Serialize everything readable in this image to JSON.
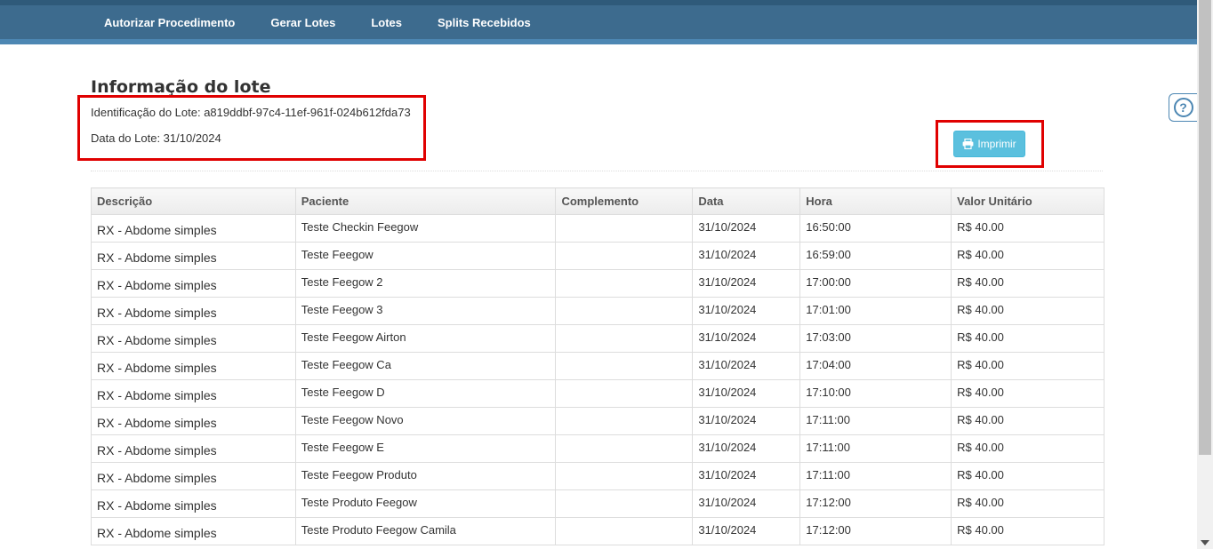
{
  "nav": {
    "items": [
      {
        "label": "Autorizar Procedimento"
      },
      {
        "label": "Gerar Lotes"
      },
      {
        "label": "Lotes"
      },
      {
        "label": "Splits Recebidos"
      }
    ]
  },
  "help": {
    "icon": "question-icon",
    "glyph": "?"
  },
  "lote": {
    "title": "Informação do lote",
    "identificacao": "Identificação do Lote: a819ddbf-97c4-11ef-961f-024b612fda73",
    "data": "Data do Lote: 31/10/2024"
  },
  "print_button": {
    "label": "Imprimir",
    "icon": "printer-icon"
  },
  "table": {
    "headers": [
      "Descrição",
      "Paciente",
      "Complemento",
      "Data",
      "Hora",
      "Valor Unitário"
    ],
    "rows": [
      [
        "RX - Abdome simples",
        "Teste Checkin Feegow",
        "",
        "31/10/2024",
        "16:50:00",
        "R$ 40.00"
      ],
      [
        "RX - Abdome simples",
        "Teste Feegow",
        "",
        "31/10/2024",
        "16:59:00",
        "R$ 40.00"
      ],
      [
        "RX - Abdome simples",
        "Teste Feegow 2",
        "",
        "31/10/2024",
        "17:00:00",
        "R$ 40.00"
      ],
      [
        "RX - Abdome simples",
        "Teste Feegow 3",
        "",
        "31/10/2024",
        "17:01:00",
        "R$ 40.00"
      ],
      [
        "RX - Abdome simples",
        "Teste Feegow Airton",
        "",
        "31/10/2024",
        "17:03:00",
        "R$ 40.00"
      ],
      [
        "RX - Abdome simples",
        "Teste Feegow Ca",
        "",
        "31/10/2024",
        "17:04:00",
        "R$ 40.00"
      ],
      [
        "RX - Abdome simples",
        "Teste Feegow D",
        "",
        "31/10/2024",
        "17:10:00",
        "R$ 40.00"
      ],
      [
        "RX - Abdome simples",
        "Teste Feegow Novo",
        "",
        "31/10/2024",
        "17:11:00",
        "R$ 40.00"
      ],
      [
        "RX - Abdome simples",
        "Teste Feegow E",
        "",
        "31/10/2024",
        "17:11:00",
        "R$ 40.00"
      ],
      [
        "RX - Abdome simples",
        "Teste Feegow Produto",
        "",
        "31/10/2024",
        "17:11:00",
        "R$ 40.00"
      ],
      [
        "RX - Abdome simples",
        "Teste Produto Feegow",
        "",
        "31/10/2024",
        "17:12:00",
        "R$ 40.00"
      ],
      [
        "RX - Abdome simples",
        "Teste Produto Feegow Camila",
        "",
        "31/10/2024",
        "17:12:00",
        "R$ 40.00"
      ]
    ]
  },
  "colors": {
    "nav_bg": "#3d6b8e",
    "button_bg": "#5bc0de",
    "highlight": "#e00000"
  }
}
